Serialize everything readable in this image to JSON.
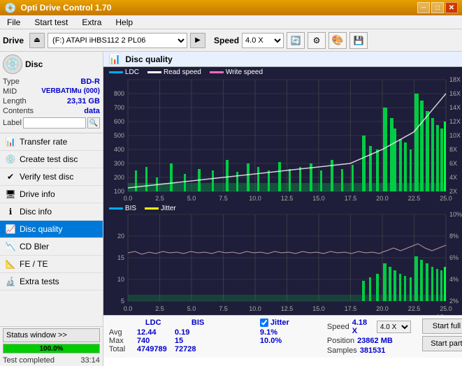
{
  "titlebar": {
    "title": "Opti Drive Control 1.70",
    "minimize": "─",
    "maximize": "□",
    "close": "✕"
  },
  "menubar": {
    "items": [
      "File",
      "Start test",
      "Extra",
      "Help"
    ]
  },
  "drivebar": {
    "label": "Drive",
    "drive_value": "(F:) ATAPI iHBS112  2 PL06",
    "speed_label": "Speed",
    "speed_value": "4.0 X"
  },
  "disc": {
    "type_label": "Type",
    "type_value": "BD-R",
    "mid_label": "MID",
    "mid_value": "VERBATIMu (000)",
    "length_label": "Length",
    "length_value": "23,31 GB",
    "contents_label": "Contents",
    "contents_value": "data",
    "label_label": "Label",
    "label_value": ""
  },
  "nav": {
    "items": [
      {
        "id": "transfer-rate",
        "label": "Transfer rate",
        "icon": "📊"
      },
      {
        "id": "create-test-disc",
        "label": "Create test disc",
        "icon": "💿"
      },
      {
        "id": "verify-test-disc",
        "label": "Verify test disc",
        "icon": "✔"
      },
      {
        "id": "drive-info",
        "label": "Drive info",
        "icon": "🖥"
      },
      {
        "id": "disc-info",
        "label": "Disc info",
        "icon": "ℹ"
      },
      {
        "id": "disc-quality",
        "label": "Disc quality",
        "icon": "📈",
        "active": true
      },
      {
        "id": "cd-bler",
        "label": "CD Bler",
        "icon": "📉"
      },
      {
        "id": "fe-te",
        "label": "FE / TE",
        "icon": "📐"
      },
      {
        "id": "extra-tests",
        "label": "Extra tests",
        "icon": "🔬"
      }
    ]
  },
  "statusbar": {
    "btn_label": "Status window >>",
    "progress_pct": 100,
    "progress_text": "100.0%",
    "status_text": "Test completed",
    "time": "33:14"
  },
  "chart": {
    "title": "Disc quality",
    "legend_ldc": "LDC",
    "legend_read": "Read speed",
    "legend_write": "Write speed",
    "legend_bis": "BIS",
    "legend_jitter": "Jitter",
    "top_y_max": 800,
    "top_y_right_max": 18,
    "bottom_y_max": 20,
    "bottom_y_right_max": 10,
    "x_max": 25.0,
    "x_labels": [
      "0.0",
      "2.5",
      "5.0",
      "7.5",
      "10.0",
      "12.5",
      "15.0",
      "17.5",
      "20.0",
      "22.5",
      "25.0"
    ],
    "top_y_labels": [
      "100",
      "200",
      "300",
      "400",
      "500",
      "600",
      "700",
      "800"
    ],
    "top_y_right_labels": [
      "2X",
      "4X",
      "6X",
      "8X",
      "10X",
      "12X",
      "14X",
      "16X",
      "18X"
    ],
    "bottom_y_left_labels": [
      "5",
      "10",
      "15",
      "20"
    ],
    "bottom_y_right_labels": [
      "2%",
      "4%",
      "6%",
      "8%",
      "10%"
    ]
  },
  "stats": {
    "ldc_header": "LDC",
    "bis_header": "BIS",
    "jitter_header": "Jitter",
    "avg_label": "Avg",
    "max_label": "Max",
    "total_label": "Total",
    "ldc_avg": "12.44",
    "ldc_max": "740",
    "ldc_total": "4749789",
    "bis_avg": "0.19",
    "bis_max": "15",
    "bis_total": "72728",
    "jitter_avg": "9.1%",
    "jitter_max": "10.0%",
    "speed_label": "Speed",
    "speed_value": "4.18 X",
    "speed_select": "4.0 X",
    "position_label": "Position",
    "position_value": "23862 MB",
    "samples_label": "Samples",
    "samples_value": "381531",
    "btn_start_full": "Start full",
    "btn_start_part": "Start part"
  }
}
